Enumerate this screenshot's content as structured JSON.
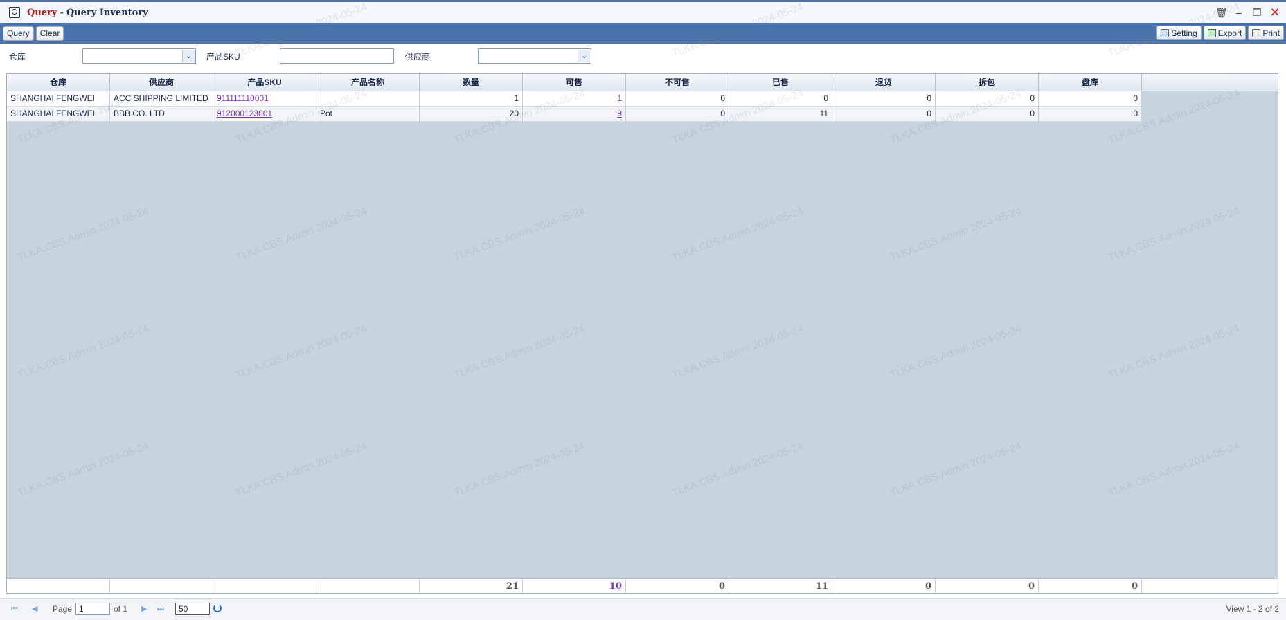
{
  "window": {
    "title_app": "Query",
    "title_separator": "-",
    "title_page": "Query Inventory"
  },
  "toolbar": {
    "query_label": "Query",
    "clear_label": "Clear",
    "setting_label": "Setting",
    "export_label": "Export",
    "print_label": "Print"
  },
  "filters": {
    "warehouse_label": "仓库",
    "sku_label": "产品SKU",
    "supplier_label": "供应商",
    "warehouse_value": "",
    "sku_value": "",
    "supplier_value": ""
  },
  "table": {
    "columns": [
      "仓库",
      "供应商",
      "产品SKU",
      "产品名称",
      "数量",
      "可售",
      "不可售",
      "已售",
      "退货",
      "拆包",
      "盘库"
    ],
    "rows": [
      {
        "warehouse": "SHANGHAI FENGWEI",
        "supplier": "ACC SHIPPING LIMITED",
        "sku": "911111110001",
        "name": "",
        "qty": "1",
        "sellable": "1",
        "unsellable": "0",
        "sold": "0",
        "returned": "0",
        "unpacked": "0",
        "stocktake": "0"
      },
      {
        "warehouse": "SHANGHAI FENGWEI",
        "supplier": "BBB CO. LTD",
        "sku": "912000123001",
        "name": "Pot",
        "qty": "20",
        "sellable": "9",
        "unsellable": "0",
        "sold": "11",
        "returned": "0",
        "unpacked": "0",
        "stocktake": "0"
      }
    ],
    "totals": {
      "qty": "21",
      "sellable": "10",
      "unsellable": "0",
      "sold": "11",
      "returned": "0",
      "unpacked": "0",
      "stocktake": "0"
    }
  },
  "pager": {
    "page_label": "Page",
    "page_value": "1",
    "of_label": "of 1",
    "page_size": "50",
    "view_text": "View 1 - 2 of 2"
  },
  "watermark": "TLKA.CBS.Admin 2024-05-24"
}
